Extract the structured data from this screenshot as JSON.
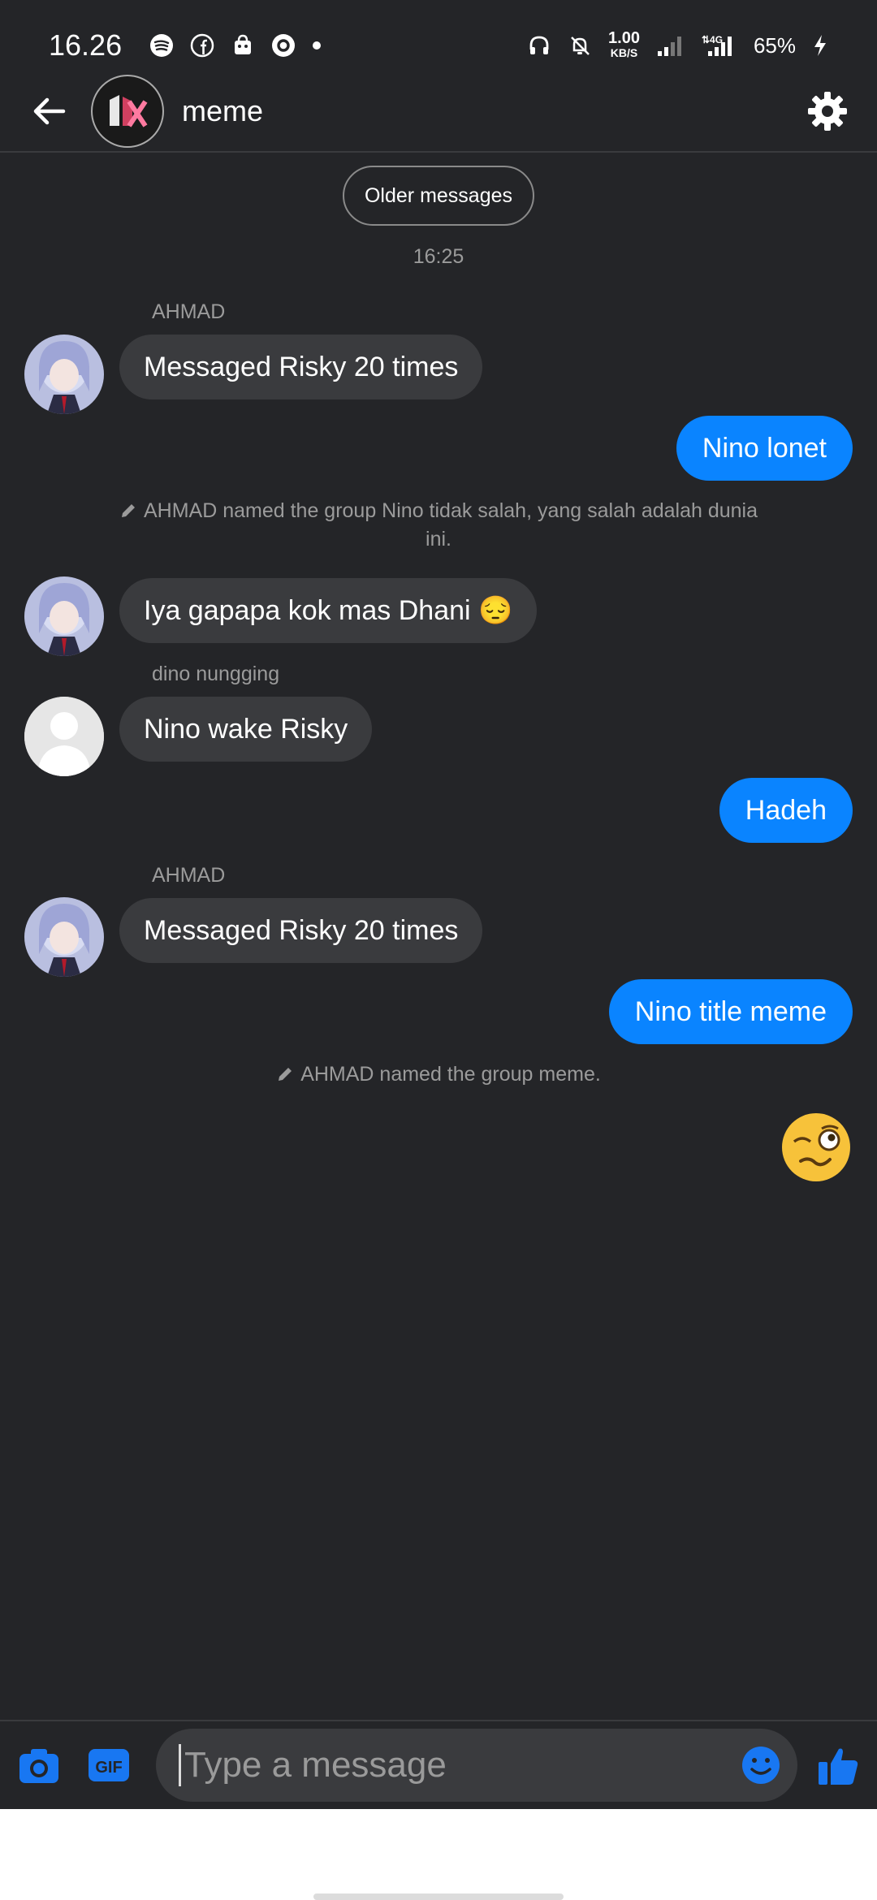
{
  "status_bar": {
    "time": "16.26",
    "net_speed_value": "1.00",
    "net_speed_unit": "KB/S",
    "network": "4G",
    "battery": "65%"
  },
  "app_bar": {
    "title": "meme"
  },
  "chat": {
    "older_messages_label": "Older messages",
    "time_separator": "16:25",
    "messages": [
      {
        "sender": "AHMAD",
        "text": "Messaged Risky 20 times",
        "direction": "in"
      },
      {
        "text": "Nino lonet",
        "direction": "out"
      },
      {
        "system": "AHMAD named the group Nino tidak salah, yang salah adalah dunia ini."
      },
      {
        "text": "Iya gapapa kok mas Dhani 😔",
        "direction": "in"
      },
      {
        "sender": "dino nungging",
        "text": "Nino wake Risky",
        "direction": "in"
      },
      {
        "text": "Hadeh",
        "direction": "out"
      },
      {
        "sender": "AHMAD",
        "text": "Messaged Risky 20 times",
        "direction": "in"
      },
      {
        "text": "Nino title meme",
        "direction": "out"
      },
      {
        "system": "AHMAD named the group meme."
      }
    ],
    "last_emoji": "🥴"
  },
  "composer": {
    "placeholder": "Type a message"
  },
  "colors": {
    "background": "#242528",
    "incoming_bubble": "#3a3b3e",
    "outgoing_bubble": "#0a84ff",
    "accent": "#1877f2"
  }
}
